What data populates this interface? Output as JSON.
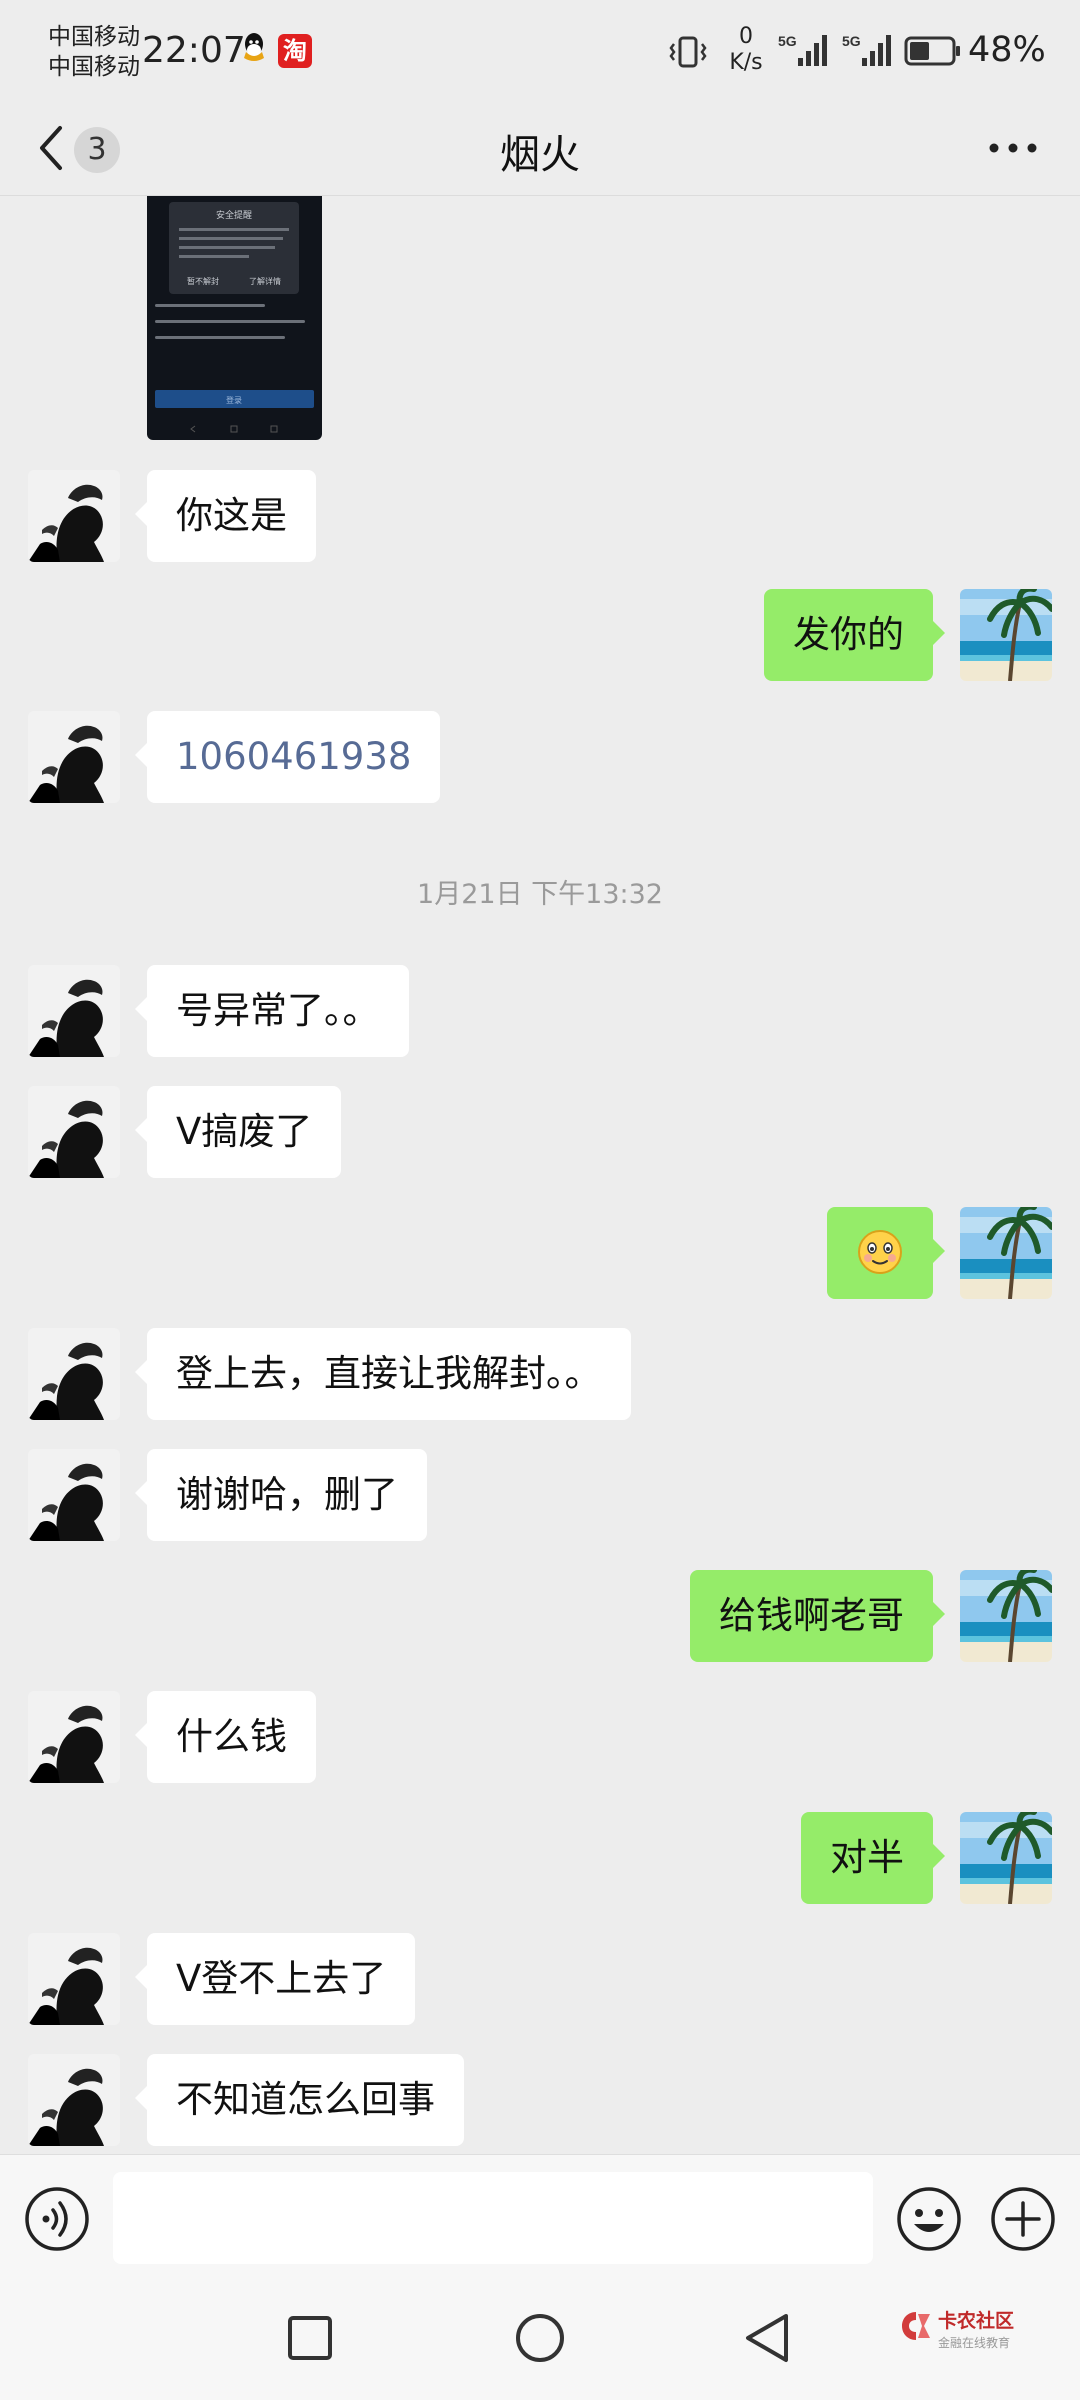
{
  "status_bar": {
    "carrier_line1": "中国移动",
    "carrier_line2": "中国移动",
    "time": "22:07",
    "net_speed_value": "0",
    "net_speed_unit": "K/s",
    "sim1_label": "5G",
    "sim2_label": "5G",
    "taobao_glyph": "淘",
    "battery_percent": "48%",
    "battery_level": 0.48
  },
  "header": {
    "unread_count": "3",
    "title": "烟火"
  },
  "messages": [
    {
      "side": "left",
      "text": "你这是"
    },
    {
      "side": "right",
      "text": "发你的"
    },
    {
      "side": "left",
      "text": "1060461938",
      "is_link": true
    },
    {
      "side": "left",
      "text": "号异常了。。"
    },
    {
      "side": "left",
      "text": "V搞废了"
    },
    {
      "side": "right",
      "emoji": "smiling-blush-emoji"
    },
    {
      "side": "left",
      "text": "登上去，直接让我解封。。"
    },
    {
      "side": "left",
      "text": "谢谢哈，删了"
    },
    {
      "side": "right",
      "text": "给钱啊老哥"
    },
    {
      "side": "left",
      "text": "什么钱"
    },
    {
      "side": "right",
      "text": "对半"
    },
    {
      "side": "left",
      "text": "V登不上去了"
    },
    {
      "side": "left",
      "text": "不知道怎么回事"
    }
  ],
  "timestamp": "1月21日 下午13:32",
  "screenshot_preview": {
    "dialog_title": "安全提醒",
    "left_action": "暂不解封",
    "right_action": "了解详情",
    "button_label": "登录"
  },
  "watermark": {
    "name": "卡农社区",
    "subtitle": "金融在线教育"
  },
  "icons": {
    "back": "chevron-left-icon",
    "more": "more-dots-icon",
    "voice": "voice-icon",
    "emoji": "emoji-icon",
    "plus": "plus-icon"
  },
  "colors": {
    "background": "#ededed",
    "bubble_self": "#95ec69",
    "bubble_other": "#ffffff",
    "link": "#576b95",
    "timestamp": "#9a9a9a"
  }
}
